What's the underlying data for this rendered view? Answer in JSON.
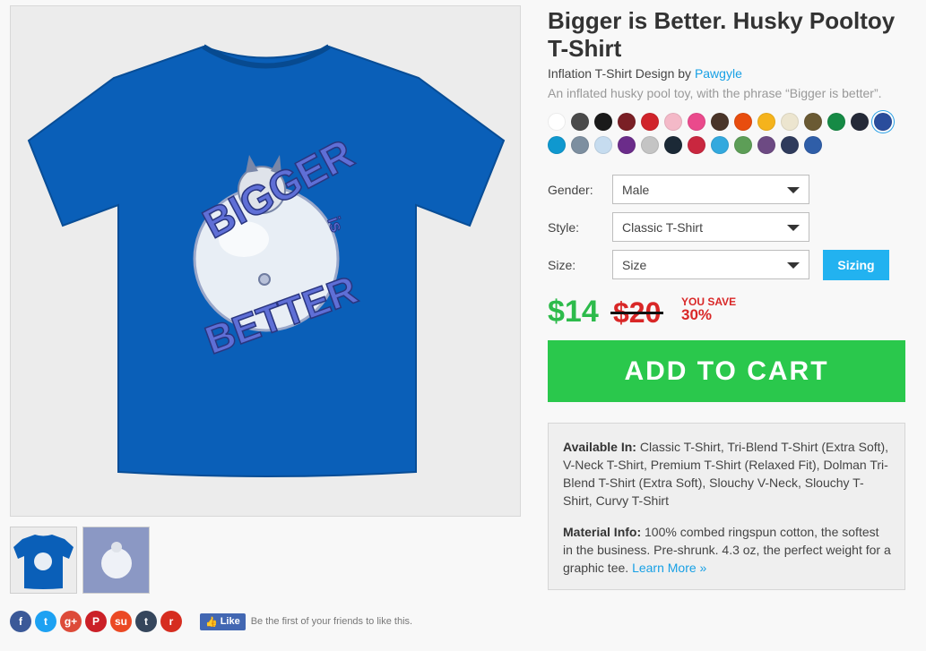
{
  "product": {
    "title": "Bigger is Better. Husky Pooltoy T-Shirt",
    "byline_prefix": "Inflation T-Shirt Design by ",
    "artist": "Pawgyle",
    "description": "An inflated husky pool toy, with the phrase “Bigger is better”."
  },
  "colors": [
    "#ffffff",
    "#4a4a4a",
    "#1a1a1a",
    "#7a1f25",
    "#d0242b",
    "#f4b9c8",
    "#ea4a8c",
    "#4a3529",
    "#e84d0e",
    "#f5b31c",
    "#ece5cf",
    "#6a5a33",
    "#168a45",
    "#252a38",
    "#2a4d9c",
    "#0f98cf",
    "#7d8fa0",
    "#c6dcef",
    "#6b2c8a",
    "#c4c4c4",
    "#1b2936",
    "#c9273f",
    "#33a9de",
    "#5d9e57",
    "#6d4a83",
    "#2f3b5c",
    "#2f5ea8"
  ],
  "selected_color_index": 14,
  "options": {
    "gender_label": "Gender:",
    "gender_value": "Male",
    "style_label": "Style:",
    "style_value": "Classic T-Shirt",
    "size_label": "Size:",
    "size_value": "Size",
    "sizing_button": "Sizing"
  },
  "pricing": {
    "price": "$14",
    "old_price": "$20",
    "you_save": "YOU SAVE",
    "percent": "30%"
  },
  "add_to_cart": "ADD TO CART",
  "info": {
    "available_label": "Available In:",
    "available_text": " Classic T-Shirt, Tri-Blend T-Shirt (Extra Soft), V-Neck T-Shirt, Premium T-Shirt (Relaxed Fit), Dolman Tri-Blend T-Shirt (Extra Soft), Slouchy V-Neck, Slouchy T-Shirt, Curvy T-Shirt",
    "material_label": "Material Info:",
    "material_text": " 100% combed ringspun cotton, the softest in the business. Pre-shrunk. 4.3 oz, the perfect weight for a graphic tee. ",
    "learn_more": "Learn More »"
  },
  "share": {
    "icons": [
      {
        "name": "facebook-icon",
        "glyph": "f",
        "color": "#3b5998"
      },
      {
        "name": "twitter-icon",
        "glyph": "t",
        "color": "#1da1f2"
      },
      {
        "name": "google-plus-icon",
        "glyph": "g+",
        "color": "#dd4b39"
      },
      {
        "name": "pinterest-icon",
        "glyph": "P",
        "color": "#cb2027"
      },
      {
        "name": "stumbleupon-icon",
        "glyph": "su",
        "color": "#eb4924"
      },
      {
        "name": "tumblr-icon",
        "glyph": "t",
        "color": "#35465c"
      },
      {
        "name": "reddit-icon",
        "glyph": "r",
        "color": "#d62d20"
      }
    ],
    "like_label": "Like",
    "like_text": "Be the first of your friends to like this."
  },
  "design": {
    "shirt_color": "#0a5fb8",
    "text_top": "BIGGER",
    "text_is": "is",
    "text_bottom": "BETTER"
  }
}
